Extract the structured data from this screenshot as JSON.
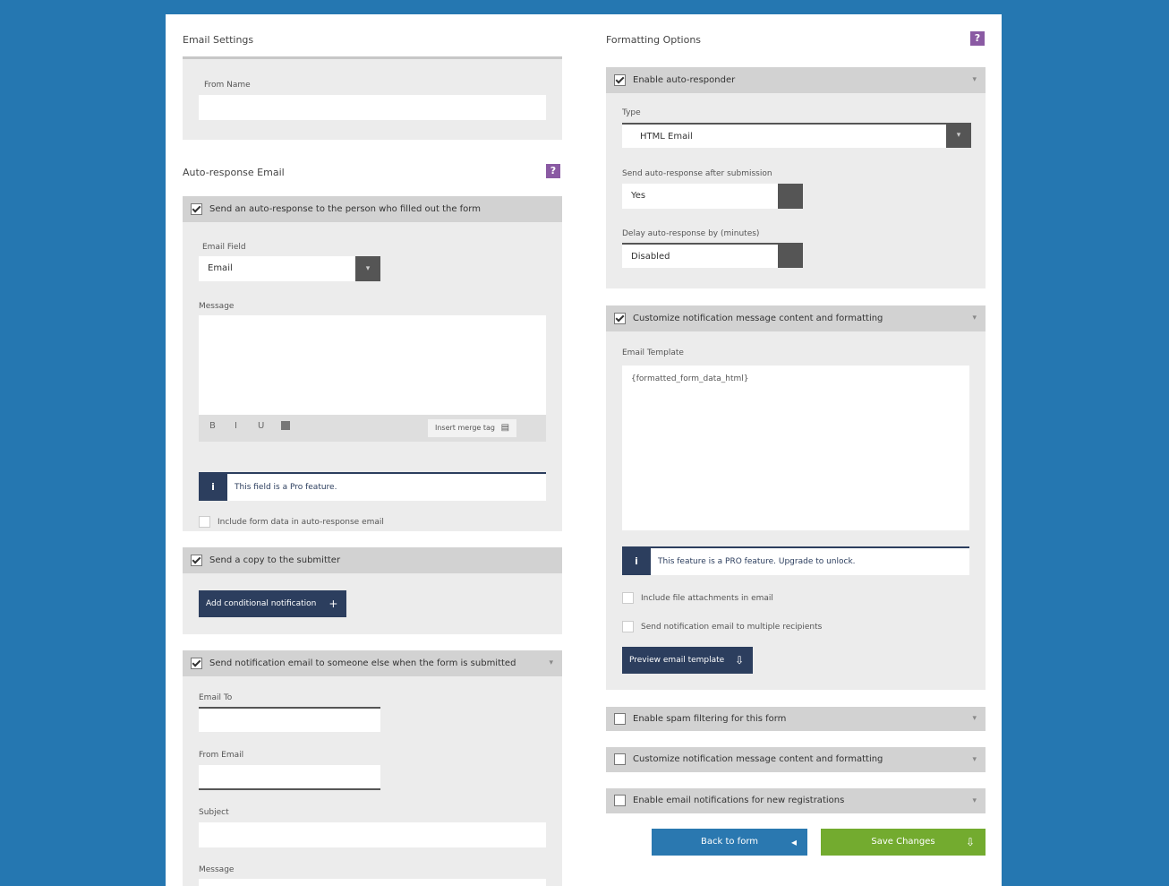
{
  "left": {
    "email_settings": {
      "title": "Email Settings",
      "from_name_label": "From Name",
      "from_name_value": ""
    },
    "auto_response": {
      "title": "Auto-response Email",
      "help": "?",
      "panel1": {
        "header": "Send an auto-response to the person who filled out the form",
        "field_label": "Email Field",
        "field_value": "Email",
        "message_label": "Message",
        "message_value": "",
        "toolbar_icons": [
          "B",
          "I",
          "U",
          "img"
        ],
        "merge_tag_button": "Insert merge tag",
        "notice": "This field is a Pro feature.",
        "checkbox": "Include form data in auto-response email"
      },
      "panel2": {
        "header": "Send a copy to the submitter",
        "add_button": "Add conditional notification",
        "add_icon": "+"
      },
      "panel3": {
        "header": "Send notification email to someone else when the form is submitted",
        "chevron": "▾",
        "to_label": "Email To",
        "to_value": "",
        "from_label": "From Email",
        "from_value": "",
        "subject_label": "Subject",
        "subject_value": "",
        "message_label": "Message",
        "message_value": ""
      }
    }
  },
  "right": {
    "title": "Formatting Options",
    "help": "?",
    "panel1": {
      "header": "Enable auto-responder",
      "chevron": "▾",
      "type_label": "Type",
      "type_value": "HTML Email",
      "type_btn": "▾",
      "send_label": "Send auto-response after submission",
      "send_value": "Yes",
      "delay_label": "Delay auto-response by (minutes)",
      "delay_value": "Disabled"
    },
    "panel2": {
      "header": "Customize notification message content and formatting",
      "chevron": "▾",
      "content_label": "Email Template",
      "content_value": "{formatted_form_data_html}",
      "notice": "This feature is a PRO feature. Upgrade to unlock.",
      "check1": "Include file attachments in email",
      "check2": "Send notification email to multiple recipients",
      "preview_button": "Preview email template",
      "preview_icon": "⇩"
    },
    "panel3": {
      "header": "Enable spam filtering for this form",
      "chevron": "▾"
    },
    "panel4": {
      "header": "Customize notification message content and formatting",
      "chevron": "▾"
    },
    "panel5": {
      "header": "Enable email notifications for new registrations",
      "chevron": "▾"
    },
    "footer": {
      "back_label": "Back to form",
      "back_icon": "◂",
      "save_label": "Save Changes",
      "save_icon": "⇩"
    }
  },
  "colors": {
    "background": "#2577b1",
    "help_purple": "#8a5aa3",
    "dark_blue": "#2c3e5e",
    "back_button": "#2a78b0",
    "save_button": "#73ab2f"
  }
}
